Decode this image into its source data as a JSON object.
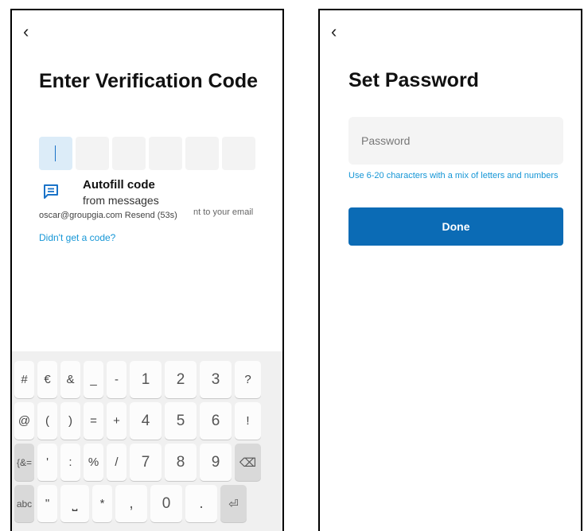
{
  "verify": {
    "back_icon": "chevron-left-icon",
    "title": "Enter Verification Code",
    "code_boxes": [
      "",
      "",
      "",
      "",
      "",
      ""
    ],
    "autofill": {
      "icon": "message-icon",
      "title": "Autofill code",
      "subtitle": "from messages"
    },
    "sent_tail": "nt to your email",
    "email_line": "oscar@groupgia.com Resend (53s)",
    "help_link": "Didn't get a code?",
    "accent_color": "#1596d6",
    "keyboard": {
      "rows": [
        [
          {
            "label": "#",
            "name": "key-hash",
            "cls": "s"
          },
          {
            "label": "€",
            "name": "key-euro",
            "cls": "s"
          },
          {
            "label": "&",
            "name": "key-ampersand",
            "cls": "s"
          },
          {
            "label": "_",
            "name": "key-underscore",
            "cls": "s"
          },
          {
            "label": "-",
            "name": "key-minus",
            "cls": "s"
          },
          {
            "label": "1",
            "name": "key-1",
            "cls": "n"
          },
          {
            "label": "2",
            "name": "key-2",
            "cls": "n"
          },
          {
            "label": "3",
            "name": "key-3",
            "cls": "n"
          },
          {
            "label": "?",
            "name": "key-question",
            "cls": "side"
          }
        ],
        [
          {
            "label": "@",
            "name": "key-at",
            "cls": "s"
          },
          {
            "label": "(",
            "name": "key-open-paren",
            "cls": "s"
          },
          {
            "label": ")",
            "name": "key-close-paren",
            "cls": "s"
          },
          {
            "label": "=",
            "name": "key-equals",
            "cls": "s"
          },
          {
            "label": "+",
            "name": "key-plus",
            "cls": "s"
          },
          {
            "label": "4",
            "name": "key-4",
            "cls": "n"
          },
          {
            "label": "5",
            "name": "key-5",
            "cls": "n"
          },
          {
            "label": "6",
            "name": "key-6",
            "cls": "n"
          },
          {
            "label": "!",
            "name": "key-exclamation",
            "cls": "side"
          }
        ],
        [
          {
            "label": "{&=",
            "name": "key-symbols-toggle",
            "cls": "s grey fn"
          },
          {
            "label": "'",
            "name": "key-apostrophe",
            "cls": "s"
          },
          {
            "label": ":",
            "name": "key-colon",
            "cls": "s"
          },
          {
            "label": "%",
            "name": "key-percent",
            "cls": "s"
          },
          {
            "label": "/",
            "name": "key-slash",
            "cls": "s"
          },
          {
            "label": "7",
            "name": "key-7",
            "cls": "n"
          },
          {
            "label": "8",
            "name": "key-8",
            "cls": "n"
          },
          {
            "label": "9",
            "name": "key-9",
            "cls": "n"
          },
          {
            "label": "⌫",
            "name": "backspace-icon",
            "cls": "side grey"
          }
        ],
        [
          {
            "label": "abc",
            "name": "key-abc",
            "cls": "s grey fn"
          },
          {
            "label": "\"",
            "name": "key-quote",
            "cls": "s"
          },
          {
            "label": "⎵",
            "name": "space-icon",
            "cls": "wide"
          },
          {
            "label": "*",
            "name": "key-asterisk",
            "cls": "s"
          },
          {
            "label": ",",
            "name": "key-comma",
            "cls": "n"
          },
          {
            "label": "0",
            "name": "key-0",
            "cls": "n"
          },
          {
            "label": ".",
            "name": "key-period",
            "cls": "n"
          },
          {
            "label": "⏎",
            "name": "enter-icon",
            "cls": "side grey"
          }
        ]
      ]
    }
  },
  "password": {
    "back_icon": "chevron-left-icon",
    "title": "Set Password",
    "input_placeholder": "Password",
    "hint": "Use 6-20 characters with a mix of letters and numbers",
    "done_label": "Done",
    "button_color": "#0b6bb5"
  }
}
